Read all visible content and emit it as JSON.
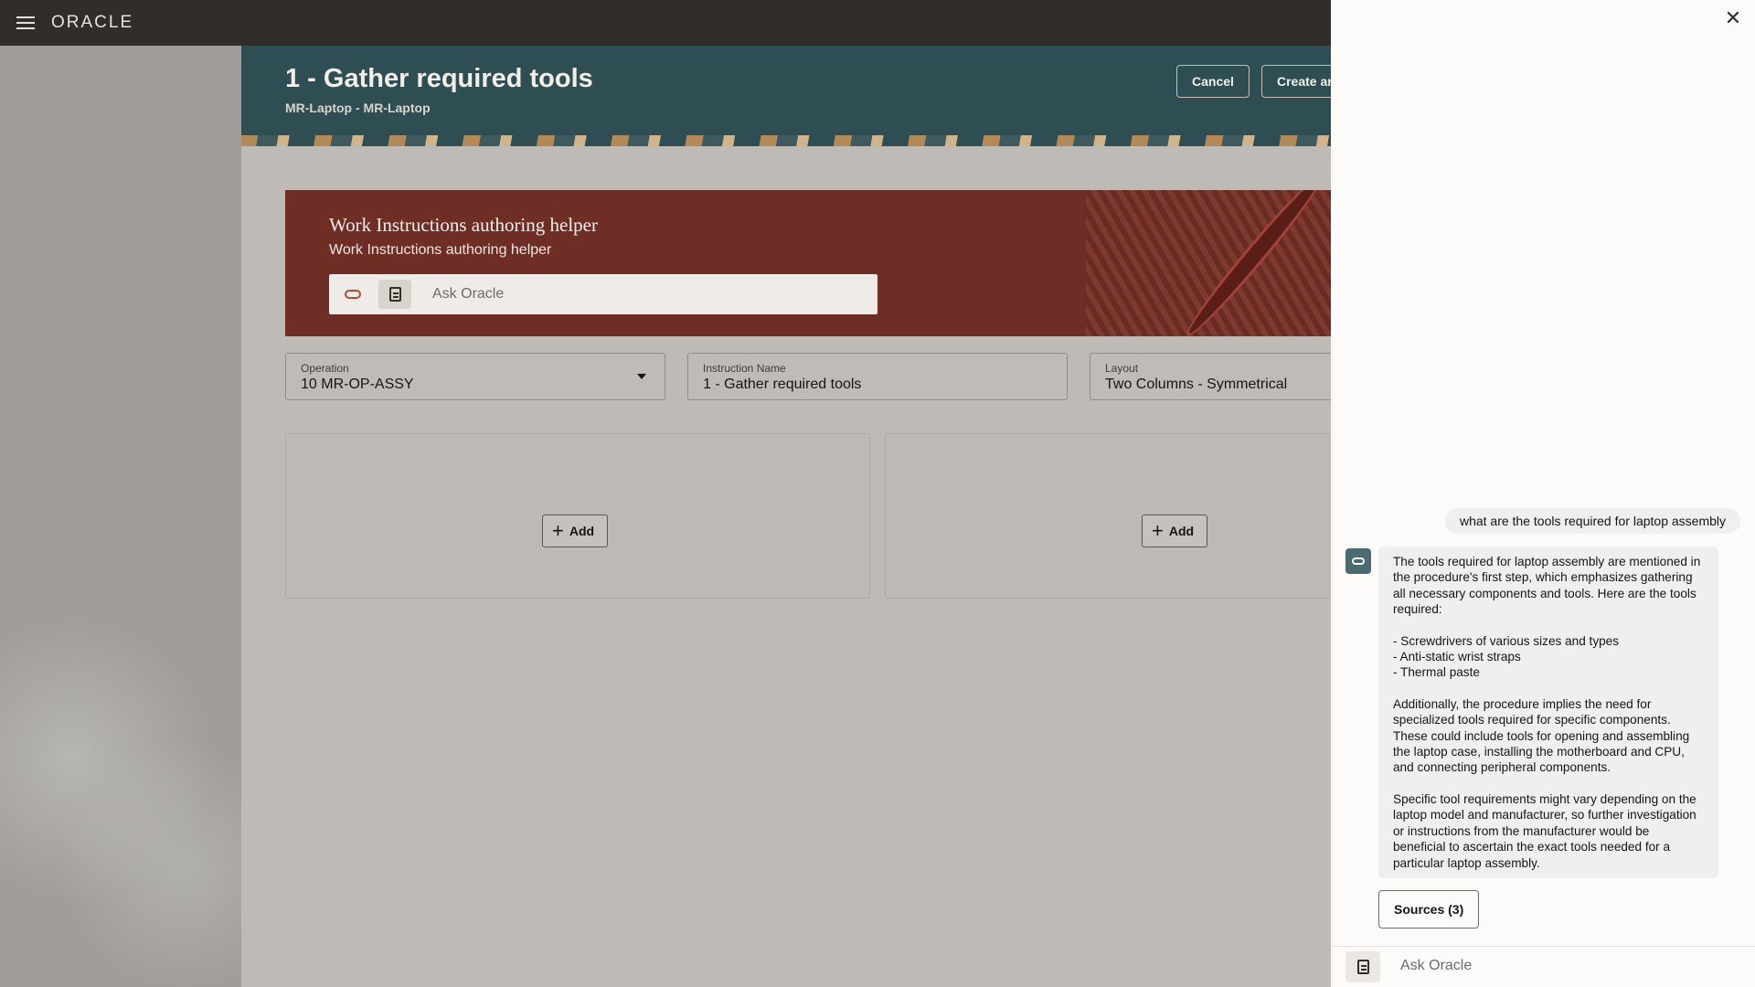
{
  "topbar": {
    "brand": "ORACLE"
  },
  "header": {
    "title": "1 - Gather required tools",
    "subtitle": "MR-Laptop - MR-Laptop",
    "cancel_label": "Cancel",
    "create_label": "Create an"
  },
  "helper": {
    "title": "Work Instructions authoring helper",
    "subtitle": "Work Instructions authoring helper",
    "ask_placeholder": "Ask Oracle"
  },
  "fields": {
    "operation": {
      "label": "Operation",
      "value": "10 MR-OP-ASSY"
    },
    "instruction_name": {
      "label": "Instruction Name",
      "value": "1 - Gather required tools"
    },
    "layout": {
      "label": "Layout",
      "value": "Two Columns - Symmetrical"
    }
  },
  "columns": {
    "col1_add_label": "Add",
    "col2_add_label": "Add"
  },
  "chat": {
    "user_message": "what are the tools required for laptop assembly",
    "bot_paragraphs": [
      "The tools required for laptop assembly are mentioned in the procedure's first step, which emphasizes gathering all necessary components and tools. Here are the tools required:",
      "- Screwdrivers of various sizes and types",
      "- Anti-static wrist straps",
      "- Thermal paste",
      "Additionally, the procedure implies the need for specialized tools required for specific components. These could include tools for opening and assembling the laptop case, installing the motherboard and CPU, and connecting peripheral components.",
      "Specific tool requirements might vary depending on the laptop model and manufacturer, so further investigation or instructions from the manufacturer would be beneficial to ascertain the exact tools needed for a particular laptop assembly."
    ],
    "sources_label": "Sources (3)",
    "ask_placeholder": "Ask Oracle"
  },
  "icons": {
    "menu": "hamburger-menu-icon",
    "close": "close-icon",
    "oracle": "oracle-logo-icon",
    "document": "document-icon",
    "plus": "plus-icon",
    "dropdown": "chevron-down-icon"
  },
  "colors": {
    "topbar": "#312d2a",
    "header": "#2f4e53",
    "helper_banner": "#6e2e26",
    "panel": "#fcfbfa"
  }
}
